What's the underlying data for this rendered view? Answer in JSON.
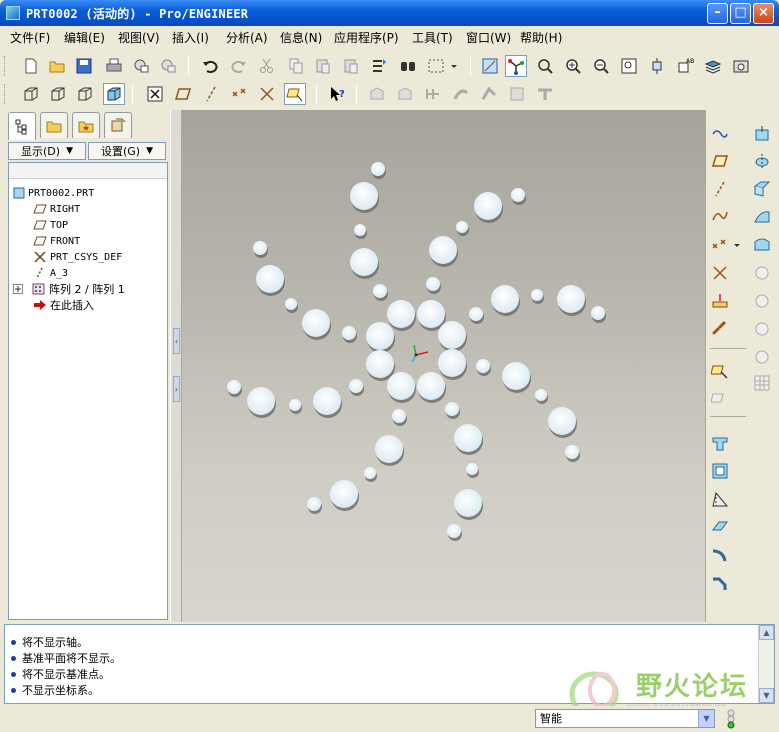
{
  "window": {
    "title": "PRT0002 (活动的) - Pro/ENGINEER"
  },
  "menu": [
    {
      "label": "文件(F)"
    },
    {
      "label": "编辑(E)"
    },
    {
      "label": "视图(V)"
    },
    {
      "label": "插入(I)"
    },
    {
      "label": "分析(A)"
    },
    {
      "label": "信息(N)"
    },
    {
      "label": "应用程序(P)"
    },
    {
      "label": "工具(T)"
    },
    {
      "label": "窗口(W)"
    },
    {
      "label": "帮助(H)"
    }
  ],
  "toolbar1_icons": [
    "new-file",
    "open-folder",
    "save",
    "print",
    "send-mail",
    "email-attach",
    "undo",
    "redo",
    "cut",
    "copy",
    "paste",
    "paste-special",
    "regenerate",
    "find",
    "select-box",
    "select-dropdown",
    "orient-display",
    "spin-center",
    "zoom-in-window",
    "zoom-in",
    "zoom-out",
    "refit",
    "orient",
    "saved-views",
    "layers",
    "model-tree-view"
  ],
  "toolbar2_icons": [
    "wireframe",
    "hidden-line",
    "no-hidden",
    "shading",
    "datum-plane-toggle-off",
    "datum-planes",
    "datum-axes",
    "datum-points",
    "coord-systems",
    "annotations",
    "context-help",
    "disabled-1",
    "disabled-2",
    "disabled-3",
    "disabled-4",
    "disabled-5",
    "disabled-6",
    "disabled-7"
  ],
  "left_panel": {
    "tabs": [
      "model-tree",
      "folder-browser",
      "favorites",
      "connections"
    ],
    "show_button": "显示(D)",
    "settings_button": "设置(G)",
    "tree": [
      {
        "label": "PRT0002.PRT",
        "icon": "part-icon"
      },
      {
        "label": "RIGHT",
        "icon": "datum-plane-icon"
      },
      {
        "label": "TOP",
        "icon": "datum-plane-icon"
      },
      {
        "label": "FRONT",
        "icon": "datum-plane-icon"
      },
      {
        "label": "PRT_CSYS_DEF",
        "icon": "csys-icon"
      },
      {
        "label": "A_3",
        "icon": "axis-icon"
      },
      {
        "label": "阵列 2 / 阵列 1",
        "icon": "pattern-icon"
      },
      {
        "label": "在此插入",
        "icon": "insert-arrow-icon"
      }
    ]
  },
  "messages": [
    "将不显示轴。",
    "基准平面将不显示。",
    "将不显示基准点。",
    "不显示坐标系。"
  ],
  "status": {
    "filter": "智能"
  },
  "watermark": {
    "text": "野火论坛",
    "url": "www.proewildfire.cn"
  },
  "colors": {
    "canvas_top": "#a6a39a",
    "canvas_bottom": "#d8d6cc",
    "circle_fill": "#e8f2f8",
    "title_blue": "#0a5fd9"
  }
}
